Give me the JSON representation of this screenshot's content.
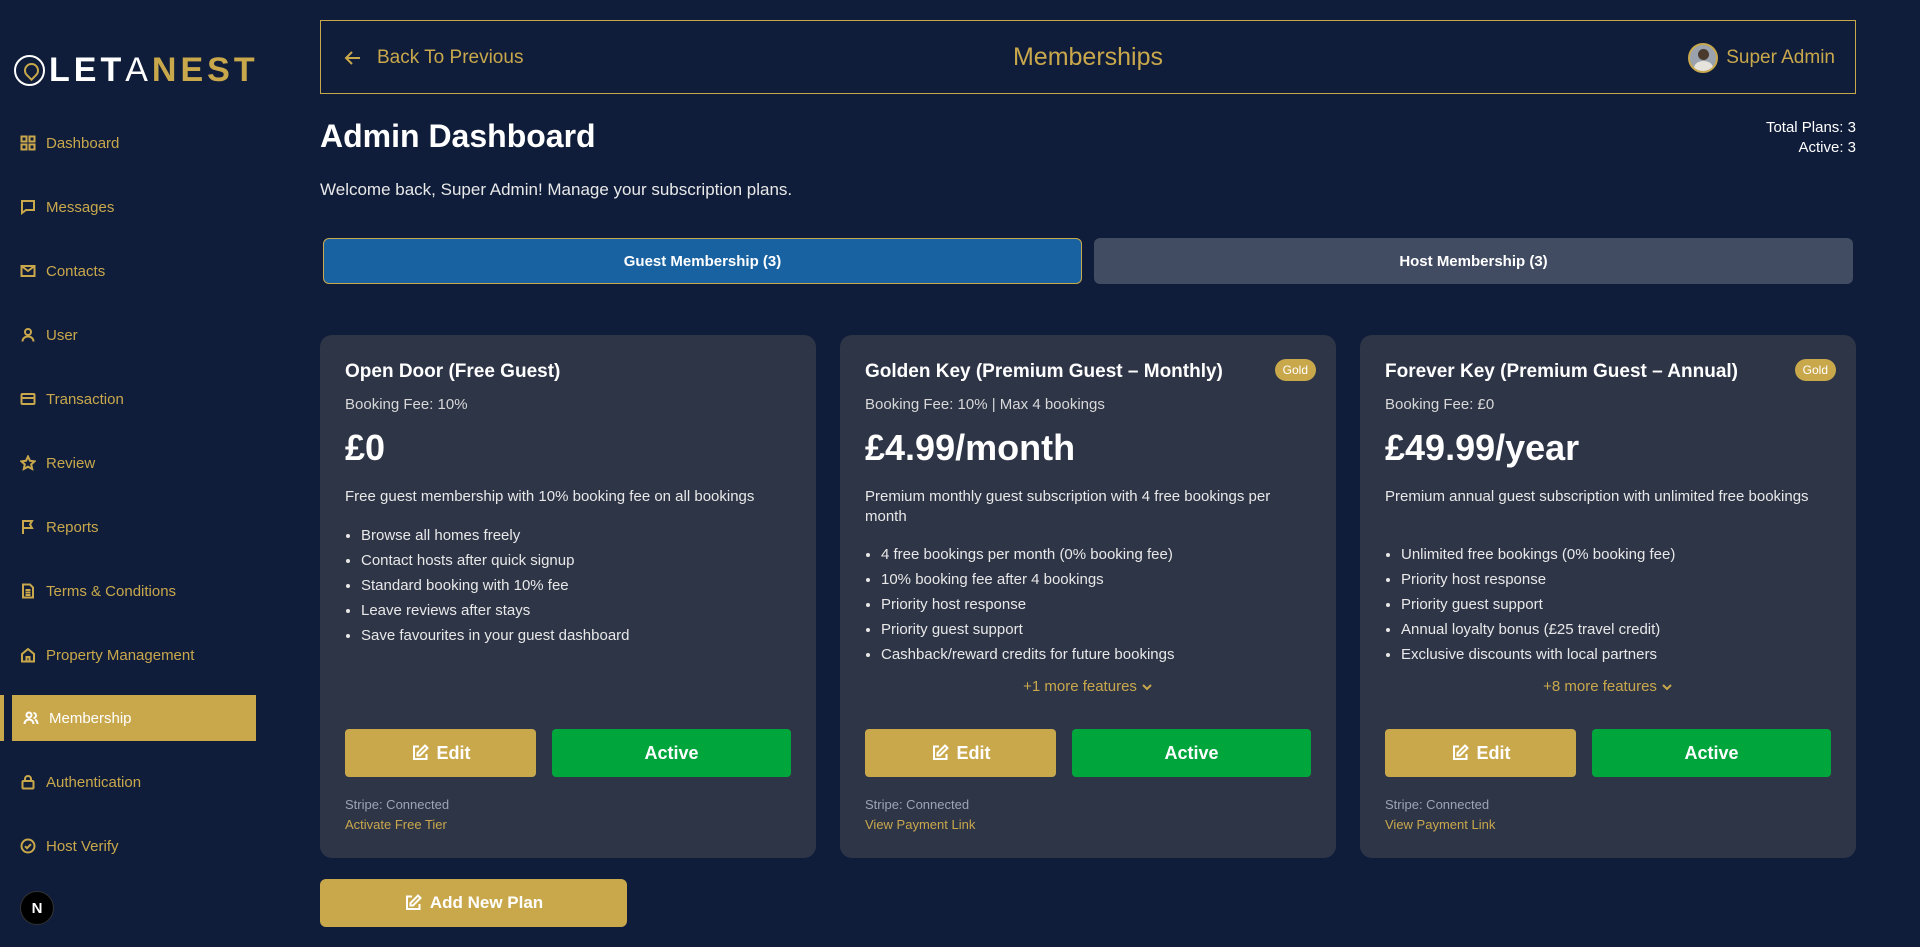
{
  "brand": {
    "name_white": "LET",
    "name_a": "A",
    "name_gold": "NEST"
  },
  "sidebar": {
    "items": [
      {
        "label": "Dashboard",
        "icon": "grid-icon"
      },
      {
        "label": "Messages",
        "icon": "message-icon"
      },
      {
        "label": "Contacts",
        "icon": "mail-icon"
      },
      {
        "label": "User",
        "icon": "user-icon"
      },
      {
        "label": "Transaction",
        "icon": "card-icon"
      },
      {
        "label": "Review",
        "icon": "star-icon"
      },
      {
        "label": "Reports",
        "icon": "flag-icon"
      },
      {
        "label": "Terms & Conditions",
        "icon": "document-icon"
      },
      {
        "label": "Property Management",
        "icon": "home-icon"
      },
      {
        "label": "Membership",
        "icon": "users-icon",
        "active": true
      },
      {
        "label": "Authentication",
        "icon": "lock-icon"
      },
      {
        "label": "Host Verify",
        "icon": "check-circle-icon"
      }
    ],
    "badge": "N"
  },
  "topbar": {
    "back_label": "Back To Previous",
    "title": "Memberships",
    "user_name": "Super Admin"
  },
  "header": {
    "title": "Admin Dashboard",
    "welcome": "Welcome back, Super Admin! Manage your subscription plans.",
    "total_plans": "Total Plans: 3",
    "active": "Active: 3"
  },
  "tabs": [
    {
      "label": "Guest Membership (3)",
      "selected": true
    },
    {
      "label": "Host Membership (3)",
      "selected": false
    }
  ],
  "plans": [
    {
      "title": "Open Door (Free Guest)",
      "badge": "",
      "fee": "Booking Fee: 10%",
      "price": "£0",
      "description": "Free guest membership with 10% booking fee on all bookings",
      "features": [
        "Browse all homes freely",
        "Contact hosts after quick signup",
        "Standard booking with 10% fee",
        "Leave reviews after stays",
        "Save favourites in your guest dashboard"
      ],
      "more": "",
      "edit_label": "Edit",
      "status_label": "Active",
      "stripe": "Stripe: Connected",
      "link": "Activate Free Tier"
    },
    {
      "title": "Golden Key (Premium Guest – Monthly)",
      "badge": "Gold",
      "fee": "Booking Fee: 10% | Max 4 bookings",
      "price": "£4.99/month",
      "description": "Premium monthly guest subscription with 4 free bookings per month",
      "features": [
        "4 free bookings per month (0% booking fee)",
        "10% booking fee after 4 bookings",
        "Priority host response",
        "Priority guest support",
        "Cashback/reward credits for future bookings"
      ],
      "more": "+1 more features",
      "edit_label": "Edit",
      "status_label": "Active",
      "stripe": "Stripe: Connected",
      "link": "View Payment Link"
    },
    {
      "title": "Forever Key (Premium Guest – Annual)",
      "badge": "Gold",
      "fee": "Booking Fee: £0",
      "price": "£49.99/year",
      "description": "Premium annual guest subscription with unlimited free bookings",
      "features": [
        "Unlimited free bookings (0% booking fee)",
        "Priority host response",
        "Priority guest support",
        "Annual loyalty bonus (£25 travel credit)",
        "Exclusive discounts with local partners"
      ],
      "more": "+8 more features",
      "edit_label": "Edit",
      "status_label": "Active",
      "stripe": "Stripe: Connected",
      "link": "View Payment Link"
    }
  ],
  "add_plan_label": "Add New Plan",
  "colors": {
    "background": "#0f1d3a",
    "gold": "#c9a84c",
    "card": "#2e3547",
    "active_green": "#00a63b",
    "tab_blue": "#1862a2",
    "tab_gray": "#414c62"
  }
}
